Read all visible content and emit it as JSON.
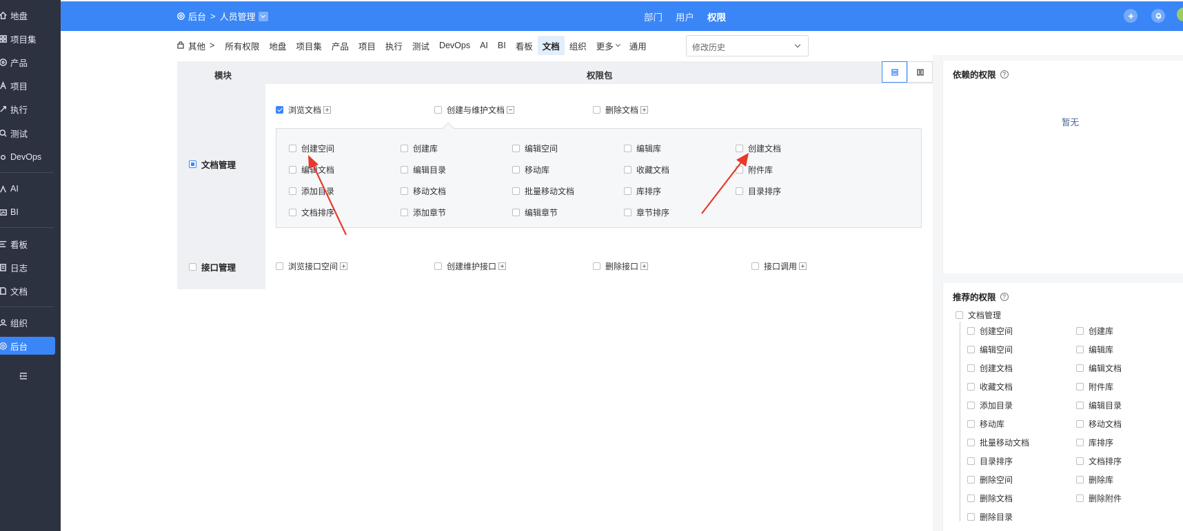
{
  "sidebar": {
    "items": [
      {
        "label": "地盘",
        "icon": "home-icon"
      },
      {
        "label": "项目集",
        "icon": "grid-icon"
      },
      {
        "label": "产品",
        "icon": "product-icon"
      },
      {
        "label": "项目",
        "icon": "project-icon"
      },
      {
        "label": "执行",
        "icon": "run-icon"
      },
      {
        "label": "测试",
        "icon": "test-icon"
      },
      {
        "label": "DevOps",
        "icon": "devops-icon"
      },
      {
        "label": "AI",
        "icon": "ai-icon"
      },
      {
        "label": "BI",
        "icon": "bi-icon"
      },
      {
        "label": "看板",
        "icon": "kanban-icon"
      },
      {
        "label": "日志",
        "icon": "log-icon"
      },
      {
        "label": "文档",
        "icon": "doc-icon"
      },
      {
        "label": "组织",
        "icon": "org-icon"
      },
      {
        "label": "后台",
        "icon": "gear-icon"
      }
    ],
    "active": "后台"
  },
  "topbar": {
    "breadcrumb_root": "后台",
    "breadcrumb_current": "人员管理",
    "tabs": [
      "部门",
      "用户",
      "权限"
    ],
    "active_tab": "权限",
    "accent_color": "#3a86f7"
  },
  "subnav": {
    "items": [
      "其他",
      "所有权限",
      "地盘",
      "项目集",
      "产品",
      "项目",
      "执行",
      "测试",
      "DevOps",
      "AI",
      "BI",
      "看板",
      "文档",
      "组织",
      "更多",
      "通用"
    ],
    "active": "文档",
    "history_placeholder": "修改历史"
  },
  "table": {
    "col_module": "模块",
    "col_pack": "权限包",
    "modules": [
      {
        "name": "文档管理",
        "packs": [
          {
            "label": "浏览文档",
            "checked": true,
            "toggle": "+"
          },
          {
            "label": "创建与维护文档",
            "checked": false,
            "toggle": "−"
          },
          {
            "label": "删除文档",
            "checked": false,
            "toggle": "+"
          }
        ],
        "sub_items": [
          "创建空间",
          "创建库",
          "编辑空间",
          "编辑库",
          "创建文档",
          "编辑文档",
          "编辑目录",
          "移动库",
          "收藏文档",
          "附件库",
          "添加目录",
          "移动文档",
          "批量移动文档",
          "库排序",
          "目录排序",
          "文档排序",
          "添加章节",
          "编辑章节",
          "章节排序"
        ]
      },
      {
        "name": "接口管理",
        "packs": [
          {
            "label": "浏览接口空间",
            "checked": false,
            "toggle": "+"
          },
          {
            "label": "创建维护接口",
            "checked": false,
            "toggle": "+"
          },
          {
            "label": "删除接口",
            "checked": false,
            "toggle": "+"
          },
          {
            "label": "接口调用",
            "checked": false,
            "toggle": "+"
          }
        ]
      }
    ]
  },
  "depends": {
    "title": "依赖的权限",
    "empty": "暂无"
  },
  "recommended": {
    "title": "推荐的权限",
    "group": "文档管理",
    "items": [
      "创建空间",
      "创建库",
      "编辑空间",
      "编辑库",
      "创建文档",
      "编辑文档",
      "收藏文档",
      "附件库",
      "添加目录",
      "编辑目录",
      "移动库",
      "移动文档",
      "批量移动文档",
      "库排序",
      "目录排序",
      "文档排序",
      "删除空间",
      "删除库",
      "删除文档",
      "删除附件",
      "删除目录"
    ]
  }
}
